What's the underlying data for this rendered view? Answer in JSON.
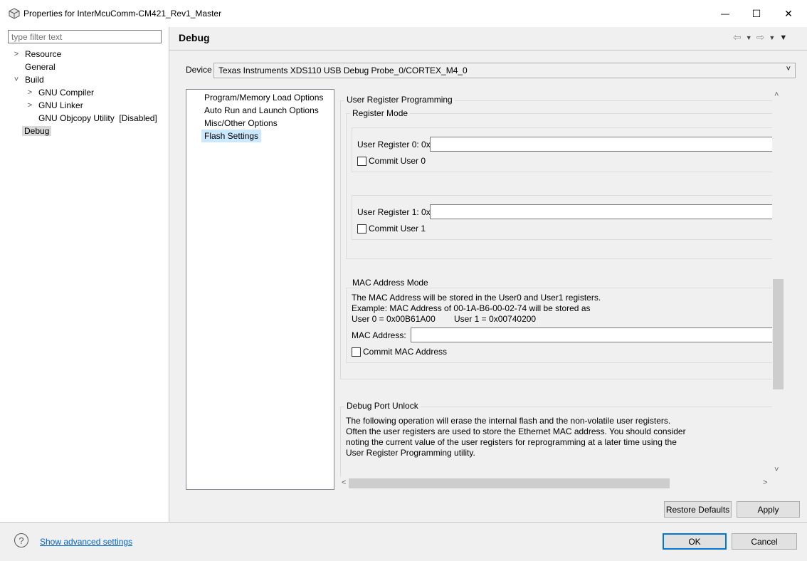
{
  "window": {
    "title": "Properties for InterMcuComm-CM421_Rev1_Master",
    "minimize": "—",
    "maximize": "☐",
    "close": "✕"
  },
  "filter": {
    "placeholder": "type filter text"
  },
  "tree": {
    "resource": "Resource",
    "general": "General",
    "build": "Build",
    "gnu_compiler": "GNU Compiler",
    "gnu_linker": "GNU Linker",
    "gnu_objcopy": "GNU Objcopy Utility  [Disabled]",
    "debug": "Debug"
  },
  "page": {
    "title": "Debug"
  },
  "device": {
    "label": "Device",
    "value": "Texas Instruments XDS110 USB Debug Probe_0/CORTEX_M4_0"
  },
  "options": {
    "program_memory": "Program/Memory Load Options",
    "auto_run": "Auto Run and Launch Options",
    "misc": "Misc/Other Options",
    "flash": "Flash Settings"
  },
  "content": {
    "user_reg_prog": "User Register Programming",
    "register_mode": "Register Mode",
    "user_reg0_label": "User Register 0: 0x",
    "user_reg0_value": "",
    "commit_user0": "Commit User 0",
    "user_reg1_label": "User Register 1: 0x",
    "user_reg1_value": "",
    "commit_user1": "Commit User 1",
    "mac_mode": "MAC Address Mode",
    "mac_line1": "The MAC Address will be stored in the User0 and User1 registers.",
    "mac_line2": "Example: MAC Address of 00-1A-B6-00-02-74 will be stored as",
    "mac_user0": "User 0 = 0x00B61A00",
    "mac_user1": "User 1 = 0x00740200",
    "mac_label": "MAC Address:",
    "mac_value": "",
    "commit_mac": "Commit MAC Address",
    "debug_unlock": "Debug Port Unlock",
    "unlock_line1": "The following operation will erase the internal flash and the non-volatile user registers.",
    "unlock_line2": "Often the user registers are used to store the Ethernet MAC address. You should consider",
    "unlock_line3": "noting the current value of the user registers for reprogramming at a later time using the",
    "unlock_line4": "User Register Programming utility."
  },
  "buttons": {
    "restore_defaults": "Restore Defaults",
    "apply": "Apply",
    "ok": "OK",
    "cancel": "Cancel"
  },
  "footer": {
    "advanced_link": "Show advanced settings"
  },
  "colors": {
    "selection": "#cce8ff",
    "link": "#0066cc",
    "ok_border": "#0078d7"
  }
}
